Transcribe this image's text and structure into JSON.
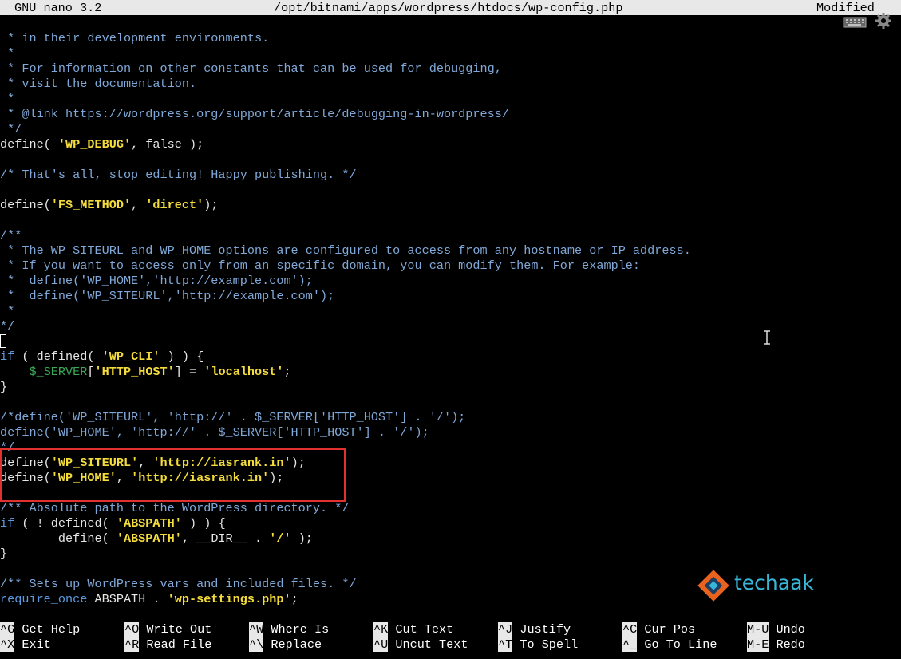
{
  "titlebar": {
    "app": "GNU nano 3.2",
    "file": "/opt/bitnami/apps/wordpress/htdocs/wp-config.php",
    "status": "Modified"
  },
  "code": [
    [
      {
        "c": "cm",
        "t": " * in their development environments."
      }
    ],
    [
      {
        "c": "cm",
        "t": " *"
      }
    ],
    [
      {
        "c": "cm",
        "t": " * For information on other constants that can be used for debugging,"
      }
    ],
    [
      {
        "c": "cm",
        "t": " * visit the documentation."
      }
    ],
    [
      {
        "c": "cm",
        "t": " *"
      }
    ],
    [
      {
        "c": "cm",
        "t": " * @link https://wordpress.org/support/article/debugging-in-wordpress/"
      }
    ],
    [
      {
        "c": "cm",
        "t": " */"
      }
    ],
    [
      {
        "c": "",
        "t": "define( "
      },
      {
        "c": "str",
        "t": "'WP_DEBUG'"
      },
      {
        "c": "",
        "t": ", false );"
      }
    ],
    [],
    [
      {
        "c": "cm",
        "t": "/* That's all, stop editing! Happy publishing. */"
      }
    ],
    [],
    [
      {
        "c": "",
        "t": "define("
      },
      {
        "c": "str",
        "t": "'FS_METHOD'"
      },
      {
        "c": "",
        "t": ", "
      },
      {
        "c": "str",
        "t": "'direct'"
      },
      {
        "c": "",
        "t": ");"
      }
    ],
    [],
    [
      {
        "c": "cm",
        "t": "/**"
      }
    ],
    [
      {
        "c": "cm",
        "t": " * The WP_SITEURL and WP_HOME options are configured to access from any hostname or IP address."
      }
    ],
    [
      {
        "c": "cm",
        "t": " * If you want to access only from an specific domain, you can modify them. For example:"
      }
    ],
    [
      {
        "c": "cm",
        "t": " *  define('WP_HOME','http://example.com');"
      }
    ],
    [
      {
        "c": "cm",
        "t": " *  define('WP_SITEURL','http://example.com');"
      }
    ],
    [
      {
        "c": "cm",
        "t": " *"
      }
    ],
    [
      {
        "c": "cm",
        "t": "*/"
      }
    ],
    [
      {
        "c": "cursor",
        "t": ""
      }
    ],
    [
      {
        "c": "kw",
        "t": "if"
      },
      {
        "c": "",
        "t": " ( defined( "
      },
      {
        "c": "str",
        "t": "'WP_CLI'"
      },
      {
        "c": "",
        "t": " ) ) {"
      }
    ],
    [
      {
        "c": "",
        "t": "    "
      },
      {
        "c": "var",
        "t": "$_SERVER"
      },
      {
        "c": "",
        "t": "["
      },
      {
        "c": "str",
        "t": "'HTTP_HOST'"
      },
      {
        "c": "",
        "t": "] = "
      },
      {
        "c": "str",
        "t": "'localhost'"
      },
      {
        "c": "",
        "t": ";"
      }
    ],
    [
      {
        "c": "",
        "t": "}"
      }
    ],
    [],
    [
      {
        "c": "cm",
        "t": "/*define('WP_SITEURL', 'http://' . $_SERVER['HTTP_HOST'] . '/');"
      }
    ],
    [
      {
        "c": "cm",
        "t": "define('WP_HOME', 'http://' . $_SERVER['HTTP_HOST'] . '/');"
      }
    ],
    [
      {
        "c": "cm",
        "t": "*/"
      }
    ],
    [
      {
        "c": "",
        "t": "define("
      },
      {
        "c": "str",
        "t": "'WP_SITEURL'"
      },
      {
        "c": "",
        "t": ", "
      },
      {
        "c": "str",
        "t": "'http://iasrank.in'"
      },
      {
        "c": "",
        "t": ");"
      }
    ],
    [
      {
        "c": "",
        "t": "define("
      },
      {
        "c": "str",
        "t": "'WP_HOME'"
      },
      {
        "c": "",
        "t": ", "
      },
      {
        "c": "str",
        "t": "'http://iasrank.in'"
      },
      {
        "c": "",
        "t": ");"
      }
    ],
    [],
    [
      {
        "c": "cm",
        "t": "/** Absolute path to the WordPress directory. */"
      }
    ],
    [
      {
        "c": "kw",
        "t": "if"
      },
      {
        "c": "",
        "t": " ( ! defined( "
      },
      {
        "c": "str",
        "t": "'ABSPATH'"
      },
      {
        "c": "",
        "t": " ) ) {"
      }
    ],
    [
      {
        "c": "",
        "t": "        define( "
      },
      {
        "c": "str",
        "t": "'ABSPATH'"
      },
      {
        "c": "",
        "t": ", __DIR__ . "
      },
      {
        "c": "str",
        "t": "'/'"
      },
      {
        "c": "",
        "t": " );"
      }
    ],
    [
      {
        "c": "",
        "t": "}"
      }
    ],
    [],
    [
      {
        "c": "cm",
        "t": "/** Sets up WordPress vars and included files. */"
      }
    ],
    [
      {
        "c": "kw",
        "t": "require_once"
      },
      {
        "c": "",
        "t": " ABSPATH . "
      },
      {
        "c": "str",
        "t": "'wp-settings.php'"
      },
      {
        "c": "",
        "t": ";"
      }
    ]
  ],
  "shortcuts": [
    {
      "key": "^G",
      "label": " Get Help"
    },
    {
      "key": "^O",
      "label": " Write Out"
    },
    {
      "key": "^W",
      "label": " Where Is"
    },
    {
      "key": "^K",
      "label": " Cut Text"
    },
    {
      "key": "^J",
      "label": " Justify"
    },
    {
      "key": "^C",
      "label": " Cur Pos"
    },
    {
      "key": "M-U",
      "label": " Undo"
    },
    {
      "key": "^X",
      "label": " Exit"
    },
    {
      "key": "^R",
      "label": " Read File"
    },
    {
      "key": "^\\",
      "label": " Replace"
    },
    {
      "key": "^U",
      "label": " Uncut Text"
    },
    {
      "key": "^T",
      "label": " To Spell"
    },
    {
      "key": "^_",
      "label": " Go To Line"
    },
    {
      "key": "M-E",
      "label": " Redo"
    }
  ],
  "logo": {
    "text": "techaak"
  },
  "icons": [
    "keyboard-icon",
    "gear-icon",
    "techaak-logo-icon",
    "text-cursor-icon"
  ],
  "colors": {
    "comment": "#7fa8d8",
    "keyword": "#5c9be0",
    "string": "#f4dc3c",
    "variable": "#3aa856",
    "highlight": "#e0312f",
    "logo": "#38b6d8"
  }
}
